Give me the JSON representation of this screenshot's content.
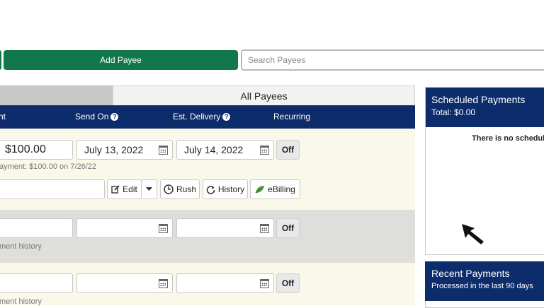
{
  "toolbar": {
    "add_payee_label": "Add Payee",
    "search_placeholder": "Search Payees"
  },
  "tabs": {
    "all_payees": "All Payees"
  },
  "columns": {
    "amount": "nt",
    "send_on": "Send On",
    "est_delivery": "Est. Delivery",
    "recurring": "Recurring",
    "help_glyph": "?"
  },
  "payees": [
    {
      "amount": "$100.00",
      "send_on": "July 13, 2022",
      "delivery": "July 14, 2022",
      "recurring": "Off",
      "note": "ayment: $100.00 on 7/26/22"
    },
    {
      "amount": "",
      "send_on": "",
      "delivery": "",
      "recurring": "Off",
      "note": "ment history"
    },
    {
      "amount": "",
      "send_on": "",
      "delivery": "",
      "recurring": "Off",
      "note": "ment history"
    }
  ],
  "actions": {
    "edit": "Edit",
    "rush": "Rush",
    "history": "History",
    "ebilling": "eBilling"
  },
  "scheduled": {
    "title": "Scheduled Payments",
    "total": "Total: $0.00",
    "empty": "There is no scheduled"
  },
  "recent": {
    "title": "Recent Payments",
    "subtitle": "Processed in the last 90 days"
  },
  "colors": {
    "brand_green": "#12774a",
    "navy": "#0d2c6b",
    "row_cream": "#faf8e8",
    "row_gray": "#dededa"
  }
}
